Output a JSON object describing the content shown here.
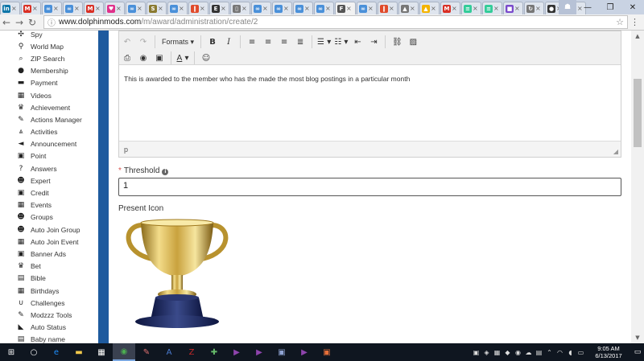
{
  "browser": {
    "tabs": [
      {
        "icon": "linkedin-icon",
        "glyph": "in",
        "color": "#0e76a8"
      },
      {
        "icon": "gmail-icon",
        "glyph": "M",
        "color": "#d93025"
      },
      {
        "icon": "link-icon",
        "glyph": "∞",
        "color": "#4a90d9"
      },
      {
        "icon": "link-icon",
        "glyph": "∞",
        "color": "#4a90d9"
      },
      {
        "icon": "gmail-icon",
        "glyph": "M",
        "color": "#d93025"
      },
      {
        "icon": "heart-icon",
        "glyph": "♥",
        "color": "#e0308a"
      },
      {
        "icon": "link-icon",
        "glyph": "∞",
        "color": "#4a90d9"
      },
      {
        "icon": "s-icon",
        "glyph": "S",
        "color": "#8a7a30"
      },
      {
        "icon": "link-icon",
        "glyph": "∞",
        "color": "#4a90d9"
      },
      {
        "icon": "pause-icon",
        "glyph": "‖",
        "color": "#e04a2a"
      },
      {
        "icon": "e-icon",
        "glyph": "E",
        "color": "#333333"
      },
      {
        "icon": "doc-icon",
        "glyph": "▯",
        "color": "#777777"
      },
      {
        "icon": "link-icon",
        "glyph": "∞",
        "color": "#4a90d9"
      },
      {
        "icon": "link-icon",
        "glyph": "∞",
        "color": "#4a90d9"
      },
      {
        "icon": "link-icon",
        "glyph": "∞",
        "color": "#4a90d9"
      },
      {
        "icon": "link-icon",
        "glyph": "∞",
        "color": "#4a90d9"
      },
      {
        "icon": "page-icon",
        "glyph": "F",
        "color": "#555555",
        "active": true
      },
      {
        "icon": "link-icon",
        "glyph": "∞",
        "color": "#4a90d9"
      },
      {
        "icon": "pause-icon",
        "glyph": "‖",
        "color": "#e04a2a"
      },
      {
        "icon": "app-icon",
        "glyph": "▲",
        "color": "#777777"
      },
      {
        "icon": "drive-icon",
        "glyph": "▲",
        "color": "#f4b400"
      },
      {
        "icon": "gmail-icon",
        "glyph": "M",
        "color": "#d93025"
      },
      {
        "icon": "sheet-icon",
        "glyph": "≡",
        "color": "#3c9"
      },
      {
        "icon": "sheet-icon",
        "glyph": "≡",
        "color": "#3c9"
      },
      {
        "icon": "purple-icon",
        "glyph": "■",
        "color": "#7a4acb"
      },
      {
        "icon": "refresh-icon",
        "glyph": "↻",
        "color": "#777777"
      },
      {
        "icon": "dark-icon",
        "glyph": "●",
        "color": "#333333"
      },
      {
        "icon": "google-icon",
        "glyph": "G",
        "color": "#4285f4"
      }
    ],
    "url_domain": "www.dolphinmods.com",
    "url_path": "/m/award/administration/create/2"
  },
  "sidebar": {
    "items": [
      {
        "icon": "spy-icon",
        "glyph": "✣",
        "label": "Spy"
      },
      {
        "icon": "map-marker-icon",
        "glyph": "⚲",
        "label": "World Map"
      },
      {
        "icon": "search-icon",
        "glyph": "⌕",
        "label": "ZIP Search"
      },
      {
        "icon": "circle-icon",
        "glyph": "●",
        "label": "Membership"
      },
      {
        "icon": "credit-card-icon",
        "glyph": "▬",
        "label": "Payment"
      },
      {
        "icon": "film-icon",
        "glyph": "▦",
        "label": "Videos"
      },
      {
        "icon": "trophy-icon",
        "glyph": "♛",
        "label": "Achievement"
      },
      {
        "icon": "wrench-icon",
        "glyph": "✎",
        "label": "Actions Manager"
      },
      {
        "icon": "road-icon",
        "glyph": "⩓",
        "label": "Activities"
      },
      {
        "icon": "bullhorn-icon",
        "glyph": "◄",
        "label": "Announcement"
      },
      {
        "icon": "money-icon",
        "glyph": "▣",
        "label": "Point"
      },
      {
        "icon": "question-icon",
        "glyph": "?",
        "label": "Answers"
      },
      {
        "icon": "users-icon",
        "glyph": "☻",
        "label": "Expert"
      },
      {
        "icon": "money-icon",
        "glyph": "▣",
        "label": "Credit"
      },
      {
        "icon": "calendar-icon",
        "glyph": "▦",
        "label": "Events"
      },
      {
        "icon": "users-icon",
        "glyph": "☻",
        "label": "Groups"
      },
      {
        "icon": "users-icon",
        "glyph": "☻",
        "label": "Auto Join Group"
      },
      {
        "icon": "calendar-icon",
        "glyph": "▦",
        "label": "Auto Join Event"
      },
      {
        "icon": "money-icon",
        "glyph": "▣",
        "label": "Banner Ads"
      },
      {
        "icon": "trophy-icon",
        "glyph": "♛",
        "label": "Bet"
      },
      {
        "icon": "book-icon",
        "glyph": "▤",
        "label": "Bible"
      },
      {
        "icon": "calendar-icon",
        "glyph": "▦",
        "label": "Birthdays"
      },
      {
        "icon": "magnet-icon",
        "glyph": "∪",
        "label": "Challenges"
      },
      {
        "icon": "wrench-icon",
        "glyph": "✎",
        "label": "Modzzz Tools"
      },
      {
        "icon": "rss-icon",
        "glyph": "◣",
        "label": "Auto Status"
      },
      {
        "icon": "book-icon",
        "glyph": "▤",
        "label": "Baby name"
      }
    ]
  },
  "editor": {
    "formats_label": "Formats",
    "body_text": "This is awarded to the member who has the made the most blog postings in a particular month",
    "status_path": "p"
  },
  "form": {
    "threshold_label": "Threshold",
    "threshold_value": "1",
    "present_icon_label": "Present Icon"
  },
  "taskbar": {
    "apps": [
      {
        "icon": "windows-start-icon",
        "glyph": "⊞",
        "color": "#ffffff"
      },
      {
        "icon": "search-icon",
        "glyph": "○",
        "color": "#ffffff"
      },
      {
        "icon": "edge-icon",
        "glyph": "e",
        "color": "#1e90ff"
      },
      {
        "icon": "file-explorer-icon",
        "glyph": "▬",
        "color": "#f2c94c"
      },
      {
        "icon": "store-icon",
        "glyph": "▦",
        "color": "#ffffff"
      },
      {
        "icon": "chrome-icon",
        "glyph": "◉",
        "color": "#4caf50",
        "active": true
      },
      {
        "icon": "paint-icon",
        "glyph": "✎",
        "color": "#e57373"
      },
      {
        "icon": "translate-icon",
        "glyph": "A",
        "color": "#4a7bd0"
      },
      {
        "icon": "filezilla-icon",
        "glyph": "Z",
        "color": "#c62828"
      },
      {
        "icon": "tools-icon",
        "glyph": "✚",
        "color": "#66bb6a"
      },
      {
        "icon": "vs-icon",
        "glyph": "▶",
        "color": "#8e44ad"
      },
      {
        "icon": "vs-icon",
        "glyph": "▶",
        "color": "#8e44ad"
      },
      {
        "icon": "window-icon",
        "glyph": "▣",
        "color": "#90a4d4"
      },
      {
        "icon": "vs-icon",
        "glyph": "▶",
        "color": "#8e44ad"
      },
      {
        "icon": "app-icon",
        "glyph": "▣",
        "color": "#e8703a"
      }
    ],
    "time": "9:05 AM",
    "date": "6/13/2017"
  }
}
